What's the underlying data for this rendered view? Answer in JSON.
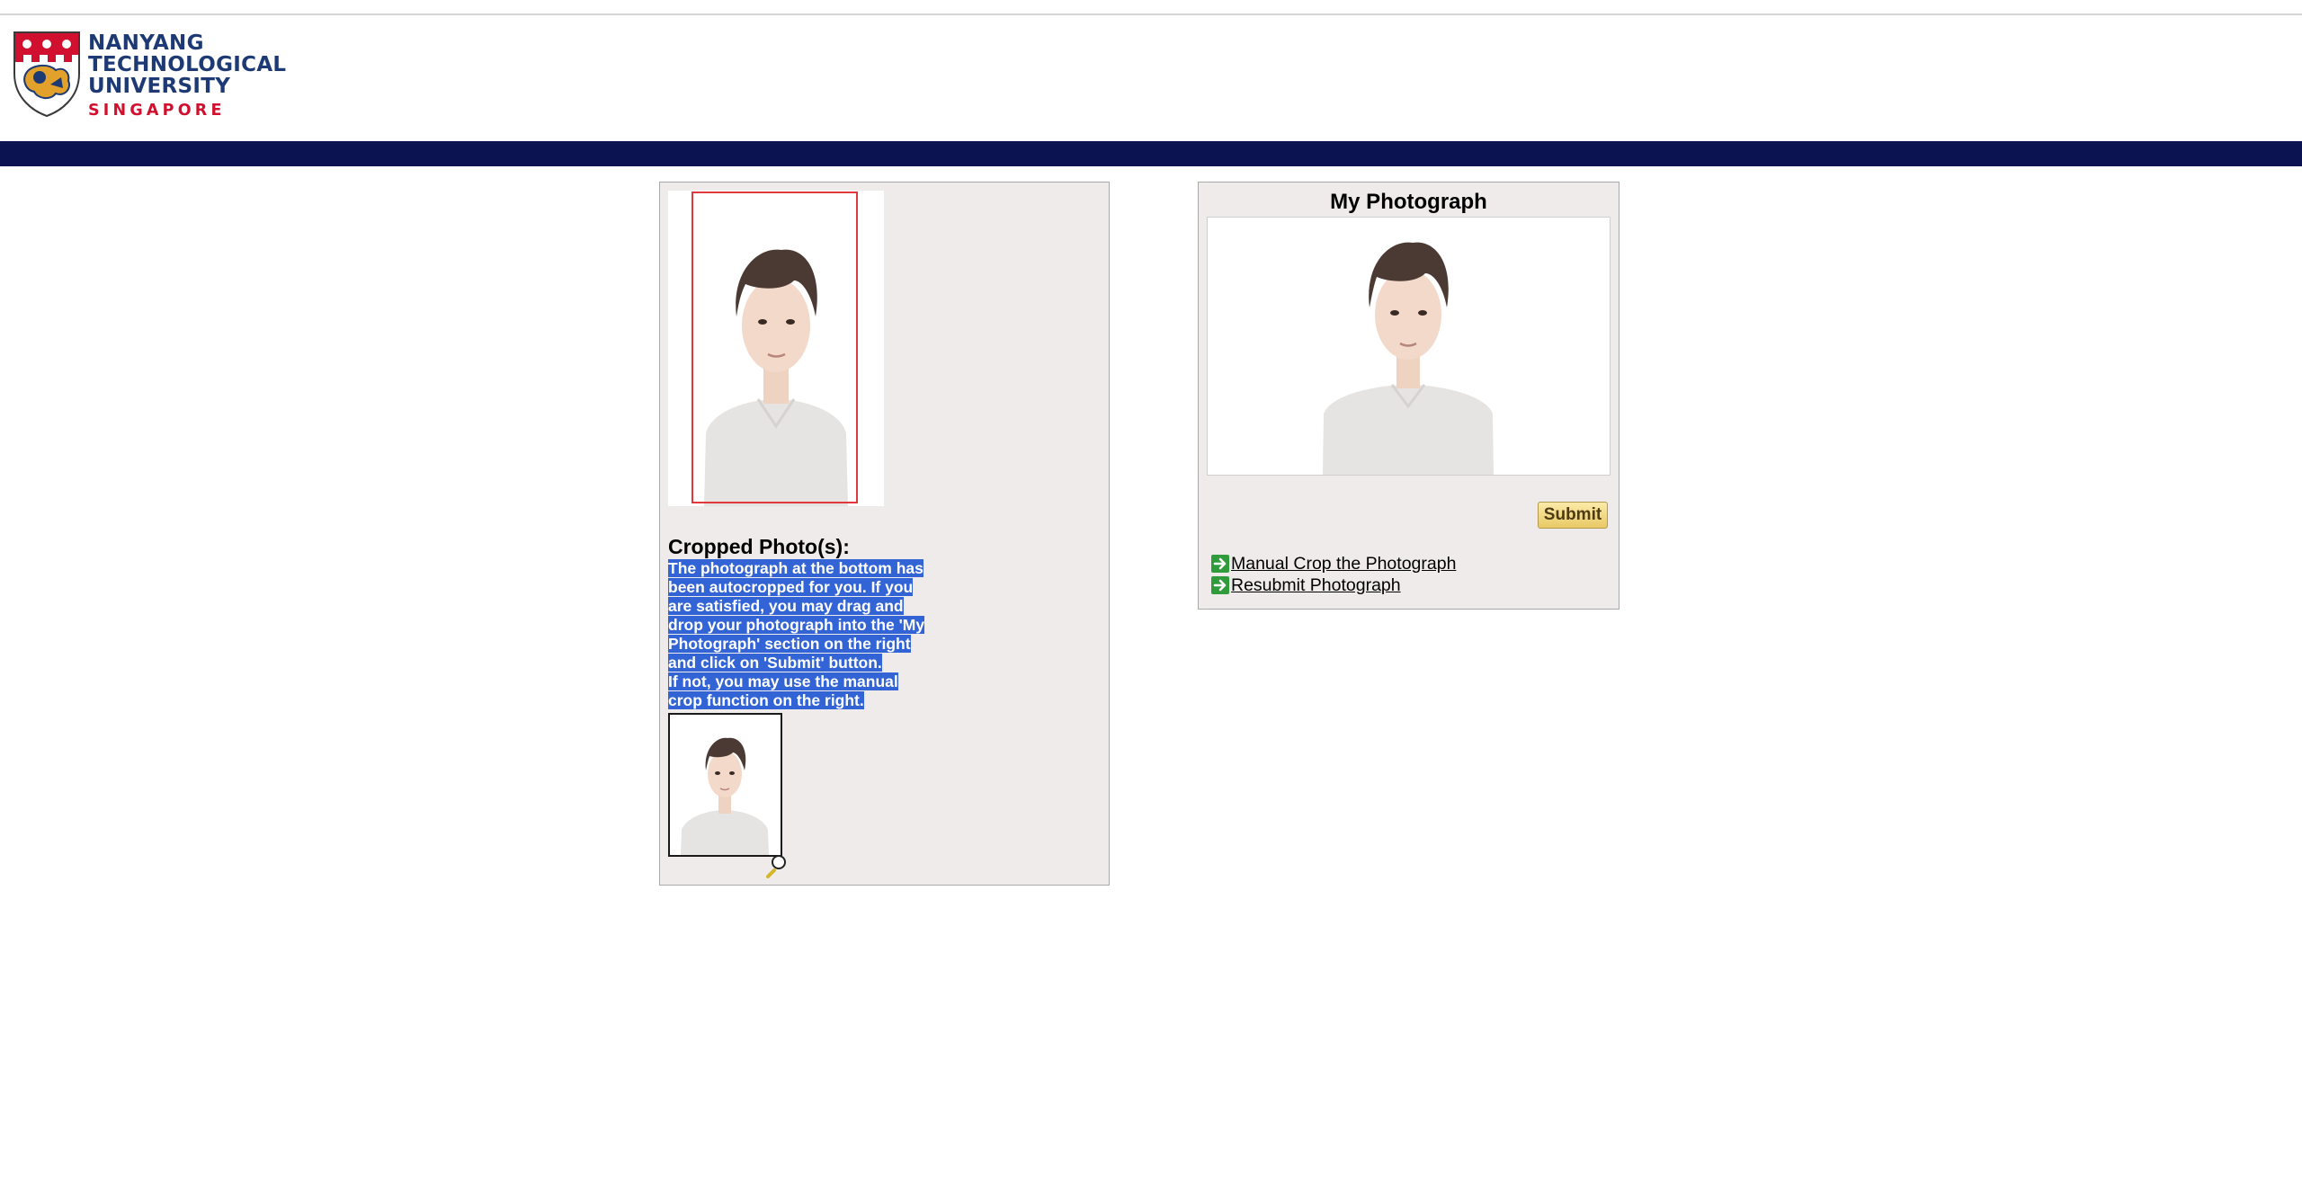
{
  "header": {
    "logo": {
      "line1": "NANYANG",
      "line2": "TECHNOLOGICAL",
      "line3": "UNIVERSITY",
      "line4": "SINGAPORE"
    },
    "colors": {
      "navy": "#0b1450",
      "brand_blue": "#1e3a75",
      "brand_red": "#d0102e"
    }
  },
  "left_panel": {
    "cropped_heading": "Cropped Photo(s):",
    "instructions": [
      "The photograph at the bottom has",
      "been autocropped for you. If you",
      "are satisfied, you may drag and",
      "drop your photograph into the 'My",
      "Photograph' section on the right",
      "and click on 'Submit' button.",
      "If not, you may use the manual",
      "crop function on the right."
    ],
    "selection_color": "#3264d6"
  },
  "right_panel": {
    "title": "My Photograph",
    "submit_label": "Submit",
    "links": {
      "manual_crop": "Manual Crop the Photograph",
      "resubmit": "Resubmit Photograph"
    }
  },
  "icons": [
    "crest-logo-icon",
    "green-arrow-icon",
    "drag-handle-icon"
  ]
}
